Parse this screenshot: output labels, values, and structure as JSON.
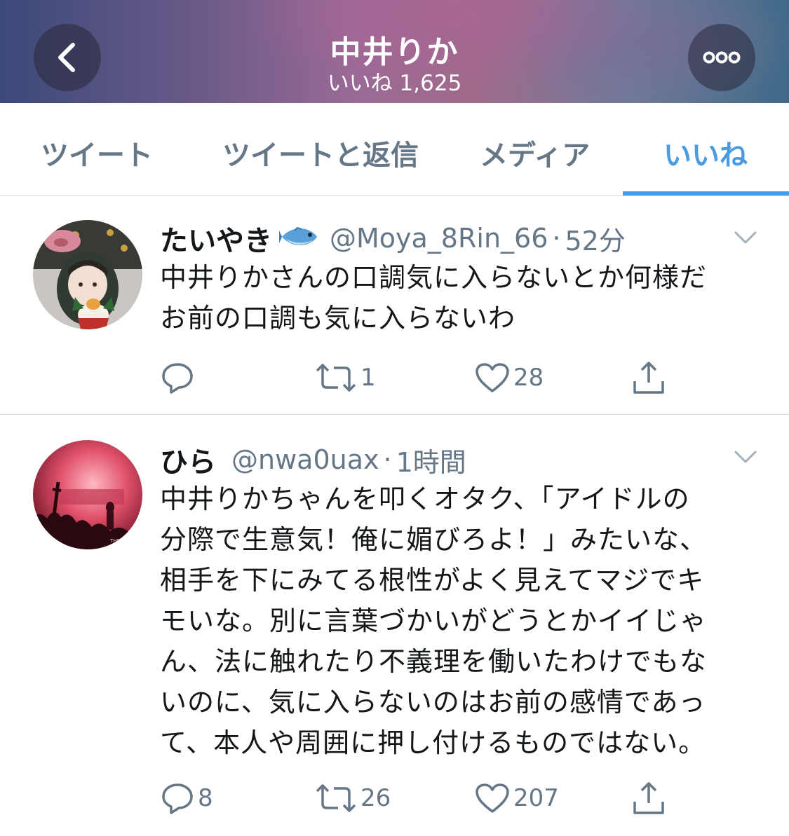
{
  "header": {
    "title": "中井りか",
    "subtitle": "いいね 1,625",
    "back_icon": "chevron-left-icon",
    "more_icon": "more-horizontal-icon"
  },
  "tabs": [
    {
      "label": "ツイート",
      "active": false
    },
    {
      "label": "ツイートと返信",
      "active": false
    },
    {
      "label": "メディア",
      "active": false
    },
    {
      "label": "いいね",
      "active": true
    }
  ],
  "accent_color": "#4a9be0",
  "tweets": [
    {
      "display_name": "たいやき",
      "name_emoji": "fish-icon",
      "handle": "@Moya_8Rin_66",
      "separator": "·",
      "time": "52分",
      "text_lines": [
        "中井りかさんの口調気に入らないとか何様だ",
        "お前の口調も気に入らないわ"
      ],
      "replies": "",
      "retweets": "1",
      "likes": "28"
    },
    {
      "display_name": "ひら",
      "handle": "@nwa0uax",
      "separator": "·",
      "time": "1時間",
      "text_lines": [
        "中井りかちゃんを叩くオタク、「アイドルの",
        "分際で生意気！俺に媚びろよ！」みたいな、",
        "相手を下にみてる根性がよく見えてマジでキ",
        "モいな。別に言葉づかいがどうとかイイじゃ",
        "ん、法に触れたり不義理を働いたわけでもな",
        "いのに、気に入らないのはお前の感情であっ",
        "て、本人や周囲に押し付けるものではない。"
      ],
      "replies": "8",
      "retweets": "26",
      "likes": "207"
    }
  ]
}
